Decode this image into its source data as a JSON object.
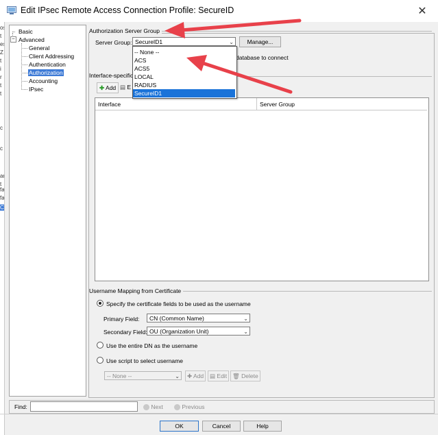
{
  "window": {
    "title": "Edit IPsec Remote Access Connection Profile: SecureID",
    "close_glyph": "✕"
  },
  "left_strip": [
    "os",
    "t",
    "es",
    "Z",
    "t",
    "i",
    "r",
    "t",
    "t",
    "c",
    "c",
    "an",
    "t",
    "fa",
    "fa",
    "C"
  ],
  "tree": {
    "items": [
      {
        "label": "Basic"
      },
      {
        "label": "Advanced"
      },
      {
        "label": "General"
      },
      {
        "label": "Client Addressing"
      },
      {
        "label": "Authentication"
      },
      {
        "label": "Authorization"
      },
      {
        "label": "Accounting"
      },
      {
        "label": "IPsec"
      }
    ]
  },
  "authorization": {
    "group_title": "Authorization Server Group",
    "server_group_label": "Server Group:",
    "server_group_value": "SecureID1",
    "manage_button": "Manage...",
    "hint_text": "database to connect",
    "dropdown_options": [
      "-- None --",
      "ACS",
      "ACS5",
      "LOCAL",
      "RADIUS",
      "SecureID1"
    ],
    "selected_index": 5
  },
  "interface": {
    "group_title": "Interface-specific",
    "add_button": "Add",
    "edit_partial": "E",
    "columns": [
      "Interface",
      "Server Group"
    ]
  },
  "username_mapping": {
    "group_title": "Username Mapping from Certificate",
    "option_fields": "Specify the certificate fields to be used as the username",
    "primary_label": "Primary Field:",
    "primary_value": "CN (Common Name)",
    "secondary_label": "Secondary Field:",
    "secondary_value": "OU (Organization Unit)",
    "option_dn": "Use the entire DN as the username",
    "option_script": "Use script to select username",
    "script_value": "-- None --",
    "add": "Add",
    "edit": "Edit",
    "delete": "Delete"
  },
  "find": {
    "label": "Find:",
    "value": "",
    "next": "Next",
    "previous": "Previous"
  },
  "footer": {
    "ok": "OK",
    "cancel": "Cancel",
    "help": "Help"
  },
  "colors": {
    "selection": "#3d7ad6",
    "annotation_arrow": "#e8414a"
  }
}
